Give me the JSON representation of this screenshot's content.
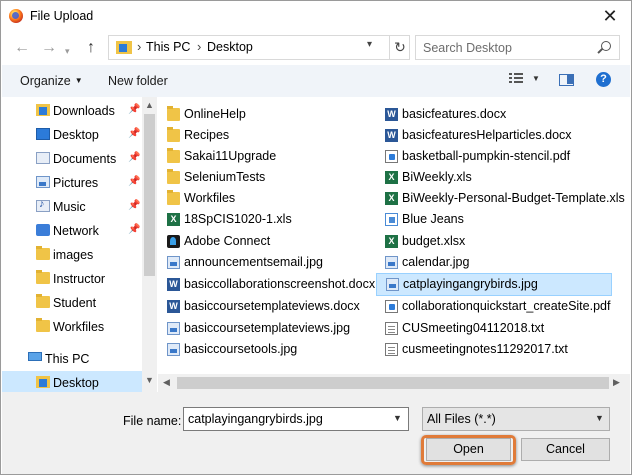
{
  "window": {
    "title": "File Upload",
    "app_icon": "firefox-icon",
    "close_label": "✕"
  },
  "address": {
    "crumbs": [
      "This PC",
      "Desktop"
    ],
    "search_placeholder": "Search Desktop"
  },
  "toolbar": {
    "organize": "Organize",
    "new_folder": "New folder",
    "help": "?"
  },
  "nav": {
    "items": [
      {
        "label": "Downloads",
        "icon": "downloads-icon",
        "pinned": true
      },
      {
        "label": "Desktop",
        "icon": "desktop-icon",
        "pinned": true
      },
      {
        "label": "Documents",
        "icon": "documents-icon",
        "pinned": true
      },
      {
        "label": "Pictures",
        "icon": "pictures-icon",
        "pinned": true
      },
      {
        "label": "Music",
        "icon": "music-icon",
        "pinned": true
      },
      {
        "label": "Network",
        "icon": "network-icon",
        "pinned": true
      },
      {
        "label": "images",
        "icon": "folder-icon",
        "pinned": false
      },
      {
        "label": "Instructor",
        "icon": "folder-icon",
        "pinned": false
      },
      {
        "label": "Student",
        "icon": "folder-icon",
        "pinned": false
      },
      {
        "label": "Workfiles",
        "icon": "folder-icon",
        "pinned": false
      },
      {
        "label": "This PC",
        "icon": "this-pc-icon",
        "pinned": false
      },
      {
        "label": "Desktop",
        "icon": "desktop-icon",
        "pinned": false,
        "selected": true
      }
    ]
  },
  "files": {
    "col1": [
      {
        "label": "OnlineHelp",
        "type": "folder"
      },
      {
        "label": "Recipes",
        "type": "folder"
      },
      {
        "label": "Sakai11Upgrade",
        "type": "folder"
      },
      {
        "label": "SeleniumTests",
        "type": "folder"
      },
      {
        "label": "Workfiles",
        "type": "folder"
      },
      {
        "label": "18SpCIS1020-1.xls",
        "type": "excel"
      },
      {
        "label": "Adobe Connect",
        "type": "adobe"
      },
      {
        "label": "announcementsemail.jpg",
        "type": "image"
      },
      {
        "label": "basiccollaborationscreenshot.docx",
        "type": "word"
      },
      {
        "label": "basiccoursetemplateviews.docx",
        "type": "word"
      },
      {
        "label": "basiccoursetemplateviews.jpg",
        "type": "image"
      },
      {
        "label": "basiccoursetools.jpg",
        "type": "image"
      }
    ],
    "col2": [
      {
        "label": "basicfeatures.docx",
        "type": "word"
      },
      {
        "label": "basicfeaturesHelparticles.docx",
        "type": "word"
      },
      {
        "label": "basketball-pumpkin-stencil.pdf",
        "type": "pdf"
      },
      {
        "label": "BiWeekly.xls",
        "type": "excel"
      },
      {
        "label": "BiWeekly-Personal-Budget-Template.xls",
        "type": "excel"
      },
      {
        "label": "Blue Jeans",
        "type": "app"
      },
      {
        "label": "budget.xlsx",
        "type": "excel"
      },
      {
        "label": "calendar.jpg",
        "type": "image"
      },
      {
        "label": "catplayingangrybirds.jpg",
        "type": "image",
        "selected": true
      },
      {
        "label": "collaborationquickstart_createSite.pdf",
        "type": "pdf"
      },
      {
        "label": "CUSmeeting04112018.txt",
        "type": "text"
      },
      {
        "label": "cusmeetingnotes11292017.txt",
        "type": "text"
      }
    ]
  },
  "bottom": {
    "file_name_label": "File name:",
    "file_name_value": "catplayingangrybirds.jpg",
    "file_type_value": "All Files (*.*)",
    "open_label": "Open",
    "cancel_label": "Cancel",
    "highlight_color": "#e07b39"
  }
}
